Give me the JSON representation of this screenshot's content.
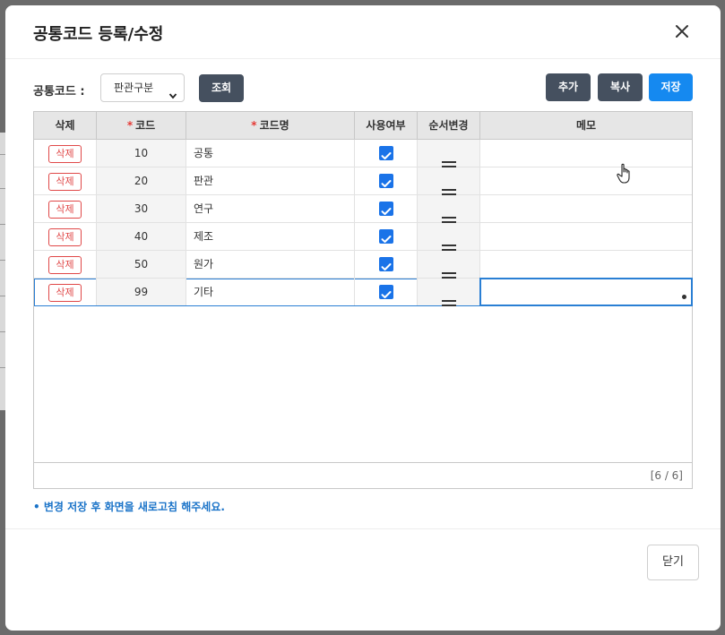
{
  "dialog": {
    "title": "공통코드 등록/수정",
    "close_icon": "close-icon"
  },
  "toolbar": {
    "label": "공통코드 :",
    "select_value": "판관구분",
    "search_label": "조회",
    "add_label": "추가",
    "copy_label": "복사",
    "save_label": "저장"
  },
  "grid": {
    "columns": {
      "delete": "삭제",
      "code": "코드",
      "name": "코드명",
      "use": "사용여부",
      "order": "순서변경",
      "memo": "메모"
    },
    "required_mark": "*",
    "delete_label": "삭제",
    "rows": [
      {
        "code": "10",
        "name": "공통",
        "use": true,
        "memo": ""
      },
      {
        "code": "20",
        "name": "판관",
        "use": true,
        "memo": ""
      },
      {
        "code": "30",
        "name": "연구",
        "use": true,
        "memo": ""
      },
      {
        "code": "40",
        "name": "제조",
        "use": true,
        "memo": ""
      },
      {
        "code": "50",
        "name": "원가",
        "use": true,
        "memo": ""
      },
      {
        "code": "99",
        "name": "기타",
        "use": true,
        "memo": ""
      }
    ],
    "selected_row_index": 5,
    "count_text": "[6 / 6]"
  },
  "notice": "• 변경 저장 후 화면을 새로고침 해주세요.",
  "footer": {
    "close_label": "닫기"
  },
  "colors": {
    "primary": "#1589f0",
    "dark_button": "#45505f",
    "delete_red": "#e04848",
    "checkbox": "#1a73e8",
    "notice_blue": "#1a73c8"
  }
}
